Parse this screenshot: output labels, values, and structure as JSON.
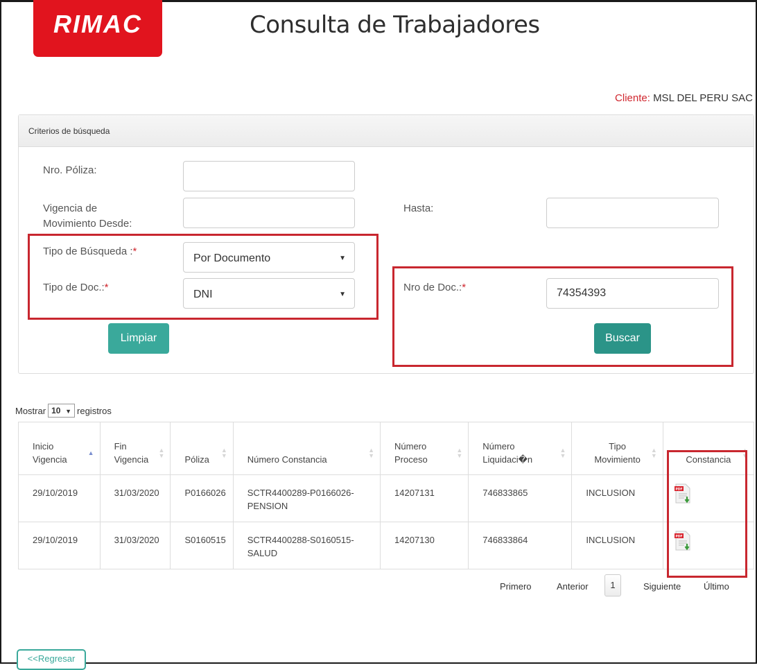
{
  "header": {
    "logo_text": "RIMAC",
    "title": "Consulta de Trabajadores",
    "client_label": "Cliente:",
    "client_value": "MSL DEL PERU SAC"
  },
  "search_panel": {
    "heading": "Criterios de búsqueda",
    "poliza_label": "Nro. Póliza:",
    "poliza_value": "",
    "vigencia_label_1": "Vigencia de",
    "vigencia_label_2": "Movimiento Desde:",
    "vigencia_value": "",
    "hasta_label": "Hasta:",
    "hasta_value": "",
    "tipo_busqueda_label": "Tipo de Búsqueda :",
    "tipo_busqueda_value": "Por Documento",
    "tipo_doc_label": "Tipo de Doc.:",
    "tipo_doc_value": "DNI",
    "nro_doc_label": "Nro de Doc.:",
    "nro_doc_value": "74354393",
    "required_mark": "*",
    "clear_label": "Limpiar",
    "search_label": "Buscar"
  },
  "table": {
    "show_prefix": "Mostrar",
    "show_value": "10",
    "show_suffix": "registros",
    "columns": [
      {
        "line1": "Inicio",
        "line2": "Vigencia"
      },
      {
        "line1": "Fin",
        "line2": "Vigencia"
      },
      {
        "line1": "",
        "line2": "Póliza"
      },
      {
        "line1": "",
        "line2": "Número Constancia"
      },
      {
        "line1": "Número",
        "line2": "Proceso"
      },
      {
        "line1": "Número",
        "line2": "Liquidaci�n"
      },
      {
        "line1": "Tipo",
        "line2": "Movimiento"
      },
      {
        "line1": "",
        "line2": "Constancia"
      }
    ],
    "rows": [
      {
        "inicio": "29/10/2019",
        "fin": "31/03/2020",
        "poliza": "P0166026",
        "constancia_1": "SCTR4400289-P0166026-",
        "constancia_2": "PENSION",
        "proceso": "14207131",
        "liquidacion": "746833865",
        "movimiento": "INCLUSION"
      },
      {
        "inicio": "29/10/2019",
        "fin": "31/03/2020",
        "poliza": "S0160515",
        "constancia_1": "SCTR4400288-S0160515-",
        "constancia_2": "SALUD",
        "proceso": "14207130",
        "liquidacion": "746833864",
        "movimiento": "INCLUSION"
      }
    ],
    "pdf_badge": "PDF"
  },
  "pagination": {
    "first": "Primero",
    "previous": "Anterior",
    "current": "1",
    "next": "Siguiente",
    "last": "Último"
  },
  "back_button": "<<Regresar",
  "colors": {
    "brand_red": "#e1141e",
    "button_teal": "#3aa99b",
    "highlight_box": "#c8272f"
  }
}
